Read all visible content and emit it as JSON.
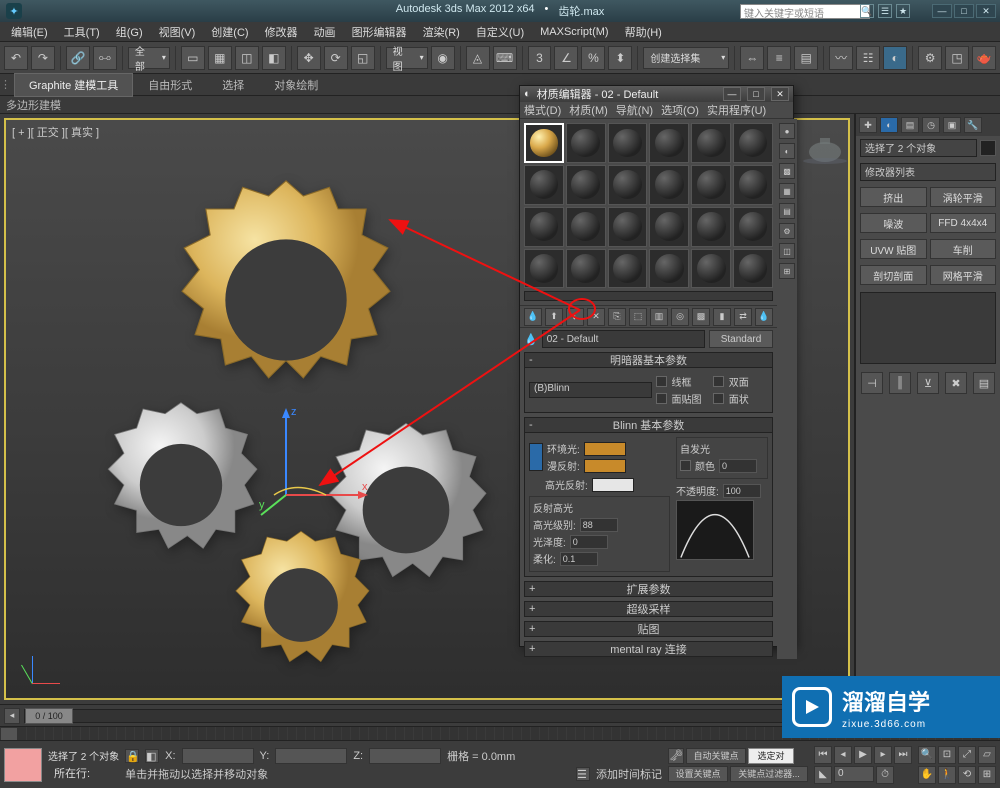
{
  "app": {
    "title": "Autodesk 3ds Max  2012  x64",
    "file": "齿轮.max",
    "search_ph": "键入关键字或短语"
  },
  "menu": [
    "编辑(E)",
    "工具(T)",
    "组(G)",
    "视图(V)",
    "创建(C)",
    "修改器",
    "动画",
    "图形编辑器",
    "渲染(R)",
    "自定义(U)",
    "MAXScript(M)",
    "帮助(H)"
  ],
  "toolbar": {
    "dd_all": "全部",
    "dd_view": "视图",
    "dd_create": "创建选择集"
  },
  "ribbon": {
    "tabs": [
      "Graphite 建模工具",
      "自由形式",
      "选择",
      "对象绘制"
    ],
    "sub": "多边形建模"
  },
  "viewport": {
    "label": "[ + ][ 正交 ][ 真实 ]"
  },
  "right": {
    "sel_text": "选择了 2 个对象",
    "mod_list": "修改器列表",
    "btns": [
      [
        "挤出",
        "涡轮平滑"
      ],
      [
        "噪波",
        "FFD 4x4x4"
      ],
      [
        "UVW 贴图",
        "车削"
      ],
      [
        "剖切剖面",
        "网格平滑"
      ]
    ]
  },
  "timeline": {
    "scrub": "0 / 100"
  },
  "status": {
    "sel": "选择了 2 个对象",
    "hint": "单击并拖动以选择并移动对象",
    "loc": "所在行:",
    "x": "X:",
    "y": "Y:",
    "z": "Z:",
    "grid": "栅格 = 0.0mm",
    "autokey": "自动关键点",
    "selkey": "选定对",
    "setkey": "设置关键点",
    "keyfilter": "关键点过滤器...",
    "addtm": "添加时间标记"
  },
  "material": {
    "title": "材质编辑器 - 02 - Default",
    "menu": [
      "模式(D)",
      "材质(M)",
      "导航(N)",
      "选项(O)",
      "实用程序(U)"
    ],
    "name": "02 - Default",
    "type": "Standard",
    "rolls": {
      "shader": "明暗器基本参数",
      "blinn": "Blinn 基本参数",
      "ext": "扩展参数",
      "ss": "超级采样",
      "maps": "贴图",
      "mr": "mental ray 连接"
    },
    "shader_dd": "(B)Blinn",
    "chk": {
      "wire": "线框",
      "two": "双面",
      "facemap": "面贴图",
      "faceted": "面状"
    },
    "blinn": {
      "selfillum": "自发光",
      "color": "颜色",
      "ambient": "环境光:",
      "diffuse": "漫反射:",
      "specular": "高光反射:",
      "opacity": "不透明度:",
      "op_v": "100",
      "ci_v": "0",
      "sh": "反射高光",
      "shlvl": "高光级别:",
      "shlvl_v": "88",
      "gloss": "光泽度:",
      "gloss_v": "0",
      "soft": "柔化:",
      "soft_v": "0.1"
    }
  },
  "watermark": {
    "t1": "溜溜自学",
    "t2": "zixue.3d66.com"
  }
}
